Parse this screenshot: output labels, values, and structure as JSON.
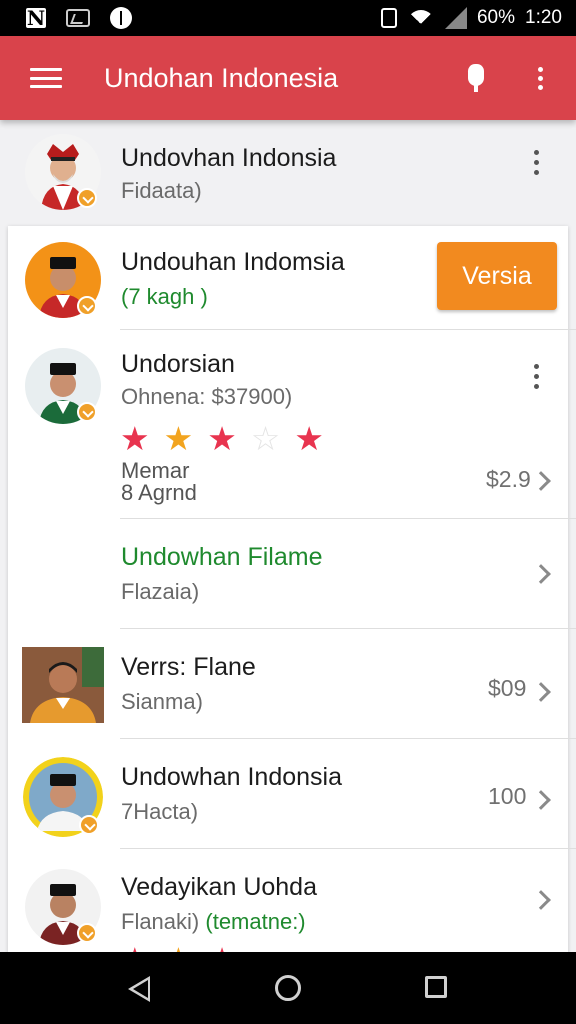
{
  "status_bar": {
    "battery": "60%",
    "time": "1:20"
  },
  "app_bar": {
    "title": "Undohan Indonesia"
  },
  "items": [
    {
      "title": "Undovhan Indonsia",
      "subtitle": "Fidaata)"
    },
    {
      "title": "Undouhan Indomsia",
      "subtitle": "(7 kagh )",
      "action_label": "Versia"
    },
    {
      "title": "Undorsian",
      "subtitle": "Ohnena: $37900)",
      "rating": 4,
      "rating_max": 5,
      "meta_line1": "Memar",
      "meta_line2": "8 Agrnd",
      "price": "$2.9"
    },
    {
      "title": "Undowhan Filame",
      "subtitle": "Flazaia)"
    },
    {
      "title": "Verrs: Flane",
      "subtitle": "Sianma)",
      "price": "$09"
    },
    {
      "title": "Undowhan Indonsia",
      "subtitle": "7Hacta)",
      "price": "100"
    },
    {
      "title": "Vedayikan Uohda",
      "subtitle": "Flanaki)",
      "subtitle_extra": "(tematne:)"
    }
  ],
  "colors": {
    "primary": "#d9434b",
    "accent": "#f28a1f",
    "green": "#1f8a2e",
    "star_red": "#e8344f",
    "star_orange": "#f2a41f"
  }
}
